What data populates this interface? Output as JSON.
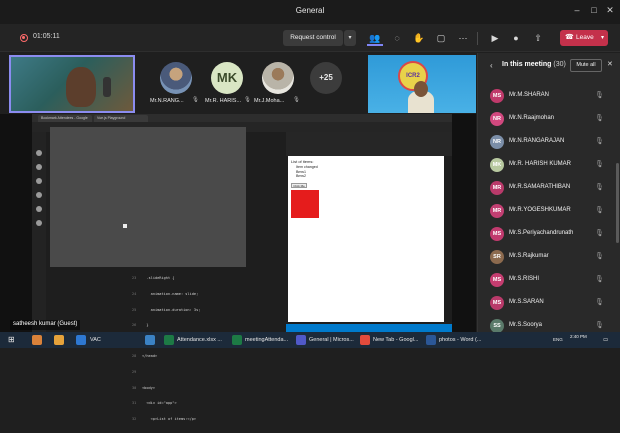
{
  "window": {
    "title": "General"
  },
  "toolbar": {
    "timer": "01:05:11",
    "request_control": "Request control",
    "leave": "Leave",
    "icons": [
      "people-icon",
      "chat-icon",
      "raise-hand-icon",
      "rooms-icon",
      "more-icon",
      "camera-icon",
      "mic-icon",
      "share-icon"
    ]
  },
  "strip": {
    "tiles": [
      {
        "name": "Mr.N.RANG..."
      },
      {
        "initials": "MK",
        "name": "Mr.R. HARIS..."
      },
      {
        "name": "Mr.J.Moha..."
      }
    ],
    "more": "+25",
    "host_logo_text": "ICR2"
  },
  "share": {
    "presenter": "satheesh kumar (Guest)",
    "tabs": [
      "Bookmark Attendees - Google",
      "Vue.js Playground"
    ],
    "preview_title": "List of items:",
    "list_items": [
      "Item changed",
      "Bmw1",
      "Bmw2"
    ],
    "preview_button": "Click Me",
    "code_lines": [
      {
        "n": "23",
        "t": "  .slideRight {"
      },
      {
        "n": "24",
        "t": "    animation-name: slide;"
      },
      {
        "n": "25",
        "t": "    animation-duration: 3s;"
      },
      {
        "n": "26",
        "t": "  }"
      },
      {
        "n": "27",
        "t": "</style>"
      },
      {
        "n": "28",
        "t": "</head>"
      },
      {
        "n": "29",
        "t": ""
      },
      {
        "n": "30",
        "t": "<body>"
      },
      {
        "n": "31",
        "t": "  <div id=\"app\">"
      },
      {
        "n": "32",
        "t": "    <p>List of items:</p>"
      }
    ]
  },
  "panel": {
    "title": "In this meeting",
    "count": "(30)",
    "mute_all": "Mute all",
    "participants": [
      {
        "name": "Mr.M.SHARAN",
        "initials": "MS",
        "color": "#c03a6b"
      },
      {
        "name": "Mr.N.Raajmohan",
        "initials": "NR",
        "color": "#d1487e"
      },
      {
        "name": "Mr.N.RANGARAJAN",
        "initials": "NR",
        "color": "#7b8ea8"
      },
      {
        "name": "Mr.R. HARISH KUMAR",
        "initials": "MK",
        "color": "#b8c9a0"
      },
      {
        "name": "Mr.R.SAMARATHIBAN",
        "initials": "MR",
        "color": "#b93a6a"
      },
      {
        "name": "Mr.R.YOGESHKUMAR",
        "initials": "MR",
        "color": "#c23f72"
      },
      {
        "name": "Mr.S.Periyachandrunath",
        "initials": "MS",
        "color": "#c13a6e"
      },
      {
        "name": "Mr.S.Rajkumar",
        "initials": "SR",
        "color": "#8c6a4e"
      },
      {
        "name": "Mr.S.RISHI",
        "initials": "MS",
        "color": "#c53d70"
      },
      {
        "name": "Mr.S.SARAN",
        "initials": "MS",
        "color": "#b93a6a"
      },
      {
        "name": "Mr.S.Soorya",
        "initials": "SS",
        "color": "#5a7a6a"
      }
    ]
  },
  "taskbar": {
    "items": [
      "VAC",
      "Attendance.xlsx ...",
      "meetingAttenda...",
      "General | Micros...",
      "New Tab - Googl...",
      "photos - Word (..."
    ],
    "lang": "ENG",
    "time": "2:40 PM"
  }
}
